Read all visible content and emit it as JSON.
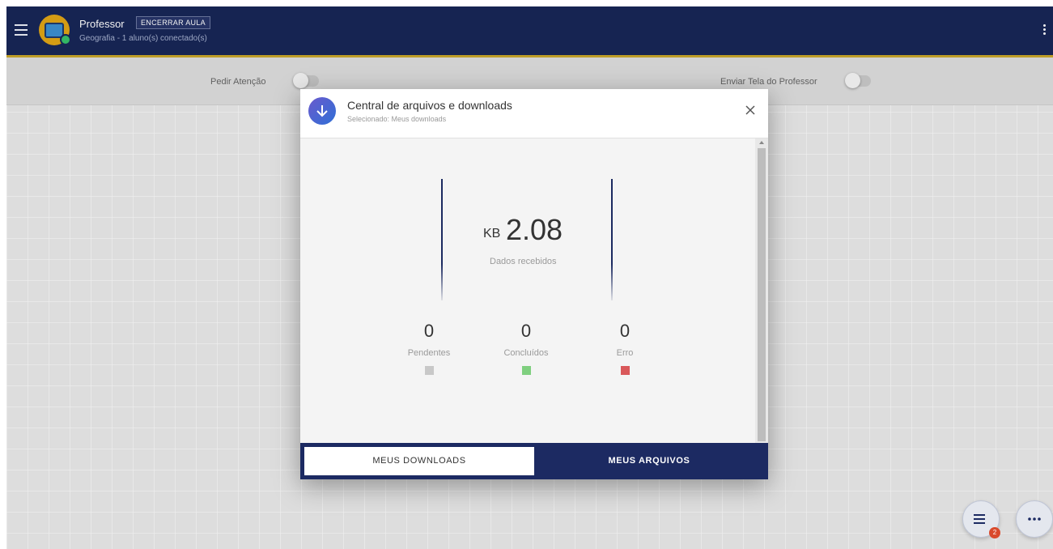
{
  "header": {
    "title": "Professor",
    "end_class_label": "ENCERRAR AULA",
    "subtitle": "Geografia - 1 aluno(s) conectado(s)"
  },
  "toolbar": {
    "attention_label": "Pedir Atenção",
    "send_screen_label": "Enviar Tela do Professor"
  },
  "modal": {
    "title": "Central de arquivos e downloads",
    "subtitle": "Selecionado: Meus downloads",
    "received": {
      "unit": "KB",
      "value": "2.08",
      "caption": "Dados recebidos"
    },
    "stats": [
      {
        "value": "0",
        "label": "Pendentes",
        "color": "#c8c8c8"
      },
      {
        "value": "0",
        "label": "Concluídos",
        "color": "#7fcf7f"
      },
      {
        "value": "0",
        "label": "Erro",
        "color": "#d9585a"
      }
    ],
    "tabs": {
      "downloads": "MEUS DOWNLOADS",
      "files": "MEUS ARQUIVOS"
    }
  },
  "fab": {
    "badge": "2"
  },
  "colors": {
    "topbar": "#182657",
    "accent_line": "#c9a62a",
    "footer": "#1c2a62"
  }
}
